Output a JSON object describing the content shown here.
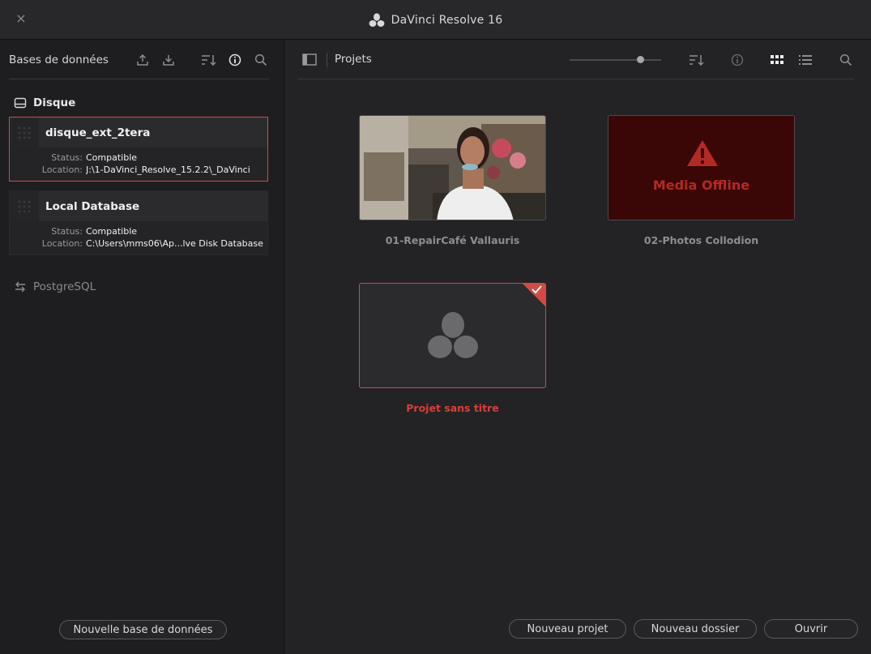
{
  "window": {
    "title": "DaVinci Resolve 16",
    "close_symbol": "×"
  },
  "colors": {
    "accent": "#d24a44",
    "offline_bg": "#3a0606",
    "offline_text": "#b32a24"
  },
  "left_panel": {
    "title": "Bases de données",
    "sections": {
      "disk": {
        "label": "Disque",
        "icon": "disk-icon"
      },
      "network": {
        "label": "PostgreSQL",
        "icon": "swap-arrows-icon"
      }
    },
    "databases": [
      {
        "name": "disque_ext_2tera",
        "status_label": "Status:",
        "status": "Compatible",
        "location_label": "Location:",
        "location": "J:\\1-DaVinci_Resolve_15.2.2\\_DaVinci",
        "selected": true
      },
      {
        "name": "Local Database",
        "status_label": "Status:",
        "status": "Compatible",
        "location_label": "Location:",
        "location": "C:\\Users\\mms06\\Ap...lve Disk Database",
        "selected": false
      }
    ],
    "header_icons": [
      "upload-icon",
      "download-icon",
      "sort-icon",
      "info-icon",
      "search-icon"
    ],
    "new_db_button": "Nouvelle base de données"
  },
  "right_panel": {
    "title": "Projets",
    "zoom_level": 0.8,
    "view_mode": "grid",
    "projects": [
      {
        "name": "01-RepairCafé Vallauris",
        "thumb": "video-frame",
        "selected": false
      },
      {
        "name": "02-Photos Collodion",
        "thumb": "offline",
        "offline_text": "Media Offline",
        "selected": false
      },
      {
        "name": "Projet sans titre",
        "thumb": "resolve-logo",
        "selected": true
      }
    ],
    "buttons": {
      "new_project": "Nouveau projet",
      "new_folder": "Nouveau dossier",
      "open": "Ouvrir"
    }
  }
}
